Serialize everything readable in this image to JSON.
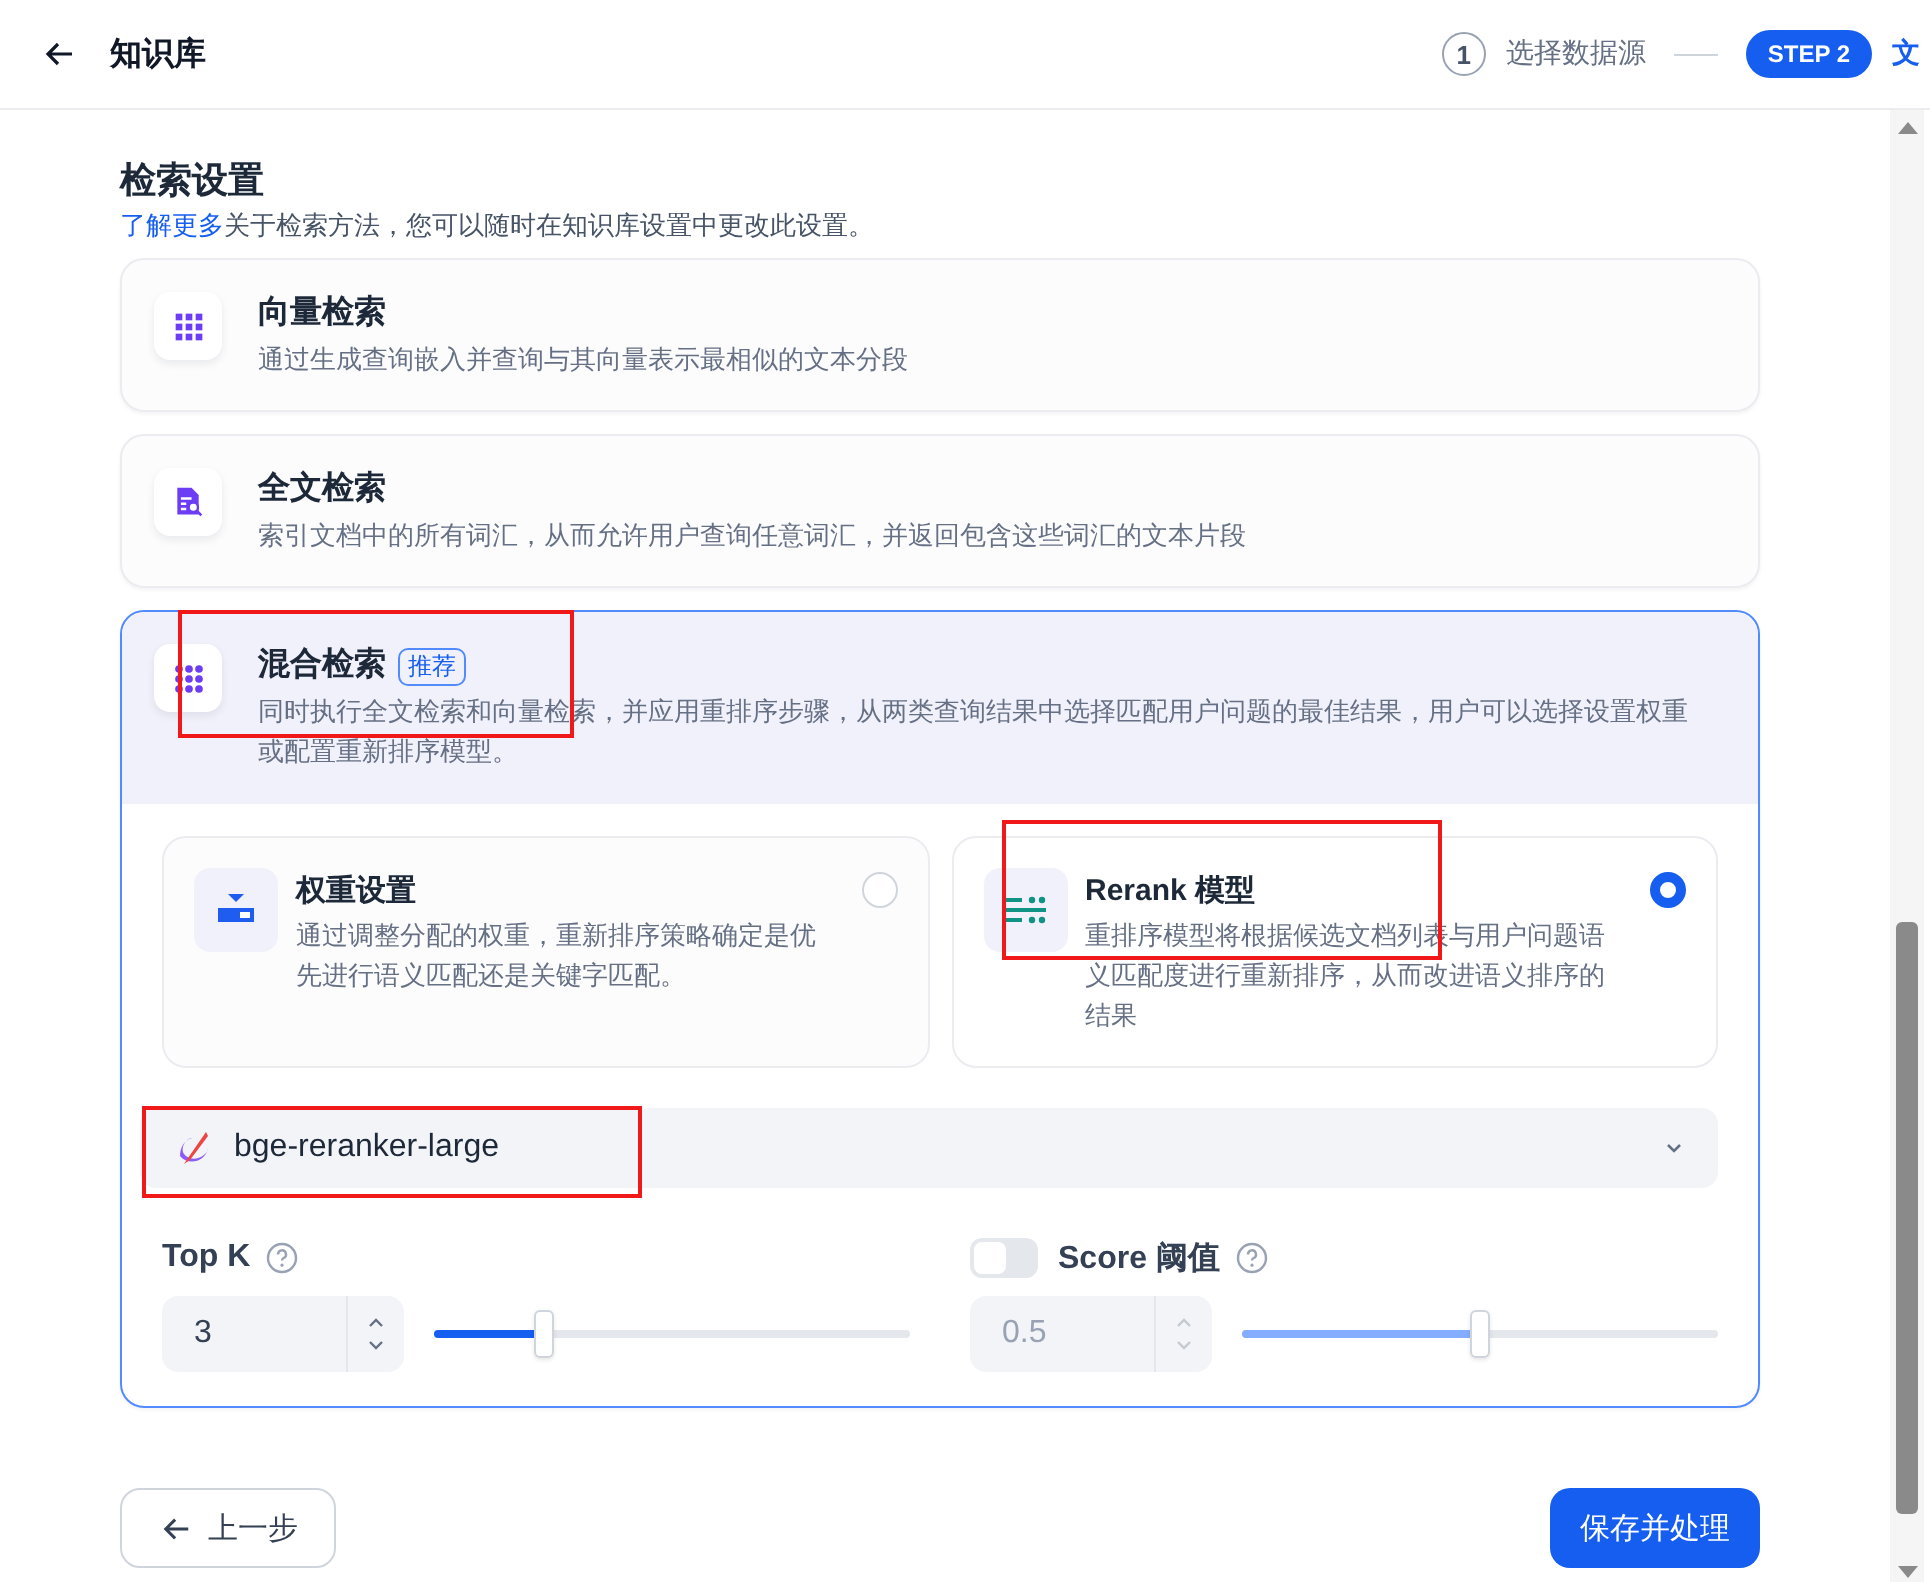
{
  "header": {
    "title": "知识库"
  },
  "steps": [
    {
      "marker": "1",
      "label": "选择数据源",
      "active": false
    },
    {
      "marker": "STEP 2",
      "label": "文",
      "active": true
    }
  ],
  "section": {
    "title": "检索设置",
    "link": "了解更多",
    "description": "关于检索方法，您可以随时在知识库设置中更改此设置。"
  },
  "methods": [
    {
      "kind": "vector",
      "title": "向量检索",
      "description": "通过生成查询嵌入并查询与其向量表示最相似的文本分段",
      "selected": false,
      "highlighted": false
    },
    {
      "kind": "fulltext",
      "title": "全文检索",
      "description": "索引文档中的所有词汇，从而允许用户查询任意词汇，并返回包含这些词汇的文本片段",
      "selected": false,
      "highlighted": false
    },
    {
      "kind": "hybrid",
      "title": "混合检索",
      "badge": "推荐",
      "description": "同时执行全文检索和向量检索，并应用重排序步骤，从两类查询结果中选择匹配用户问题的最佳结果，用户可以选择设置权重或配置重新排序模型。",
      "selected": true,
      "highlighted": true
    }
  ],
  "hybrid_options": [
    {
      "kind": "weight",
      "title": "权重设置",
      "description": "通过调整分配的权重，重新排序策略确定是优先进行语义匹配还是关键字匹配。",
      "selected": false,
      "highlighted": false
    },
    {
      "kind": "rerank",
      "title": "Rerank 模型",
      "description": "重排序模型将根据候选文档列表与用户问题语义匹配度进行重新排序，从而改进语义排序的结果",
      "selected": true,
      "highlighted": true
    }
  ],
  "rerank_model": {
    "value": "bge-reranker-large",
    "highlighted": true
  },
  "top_k": {
    "label": "Top K",
    "value": "3",
    "level": 0.23
  },
  "score_threshold": {
    "label": "Score 阈值",
    "enabled": false,
    "value": "0.5",
    "level": 0.5
  },
  "buttons": {
    "back": "上一步",
    "save": "保存并处理"
  }
}
